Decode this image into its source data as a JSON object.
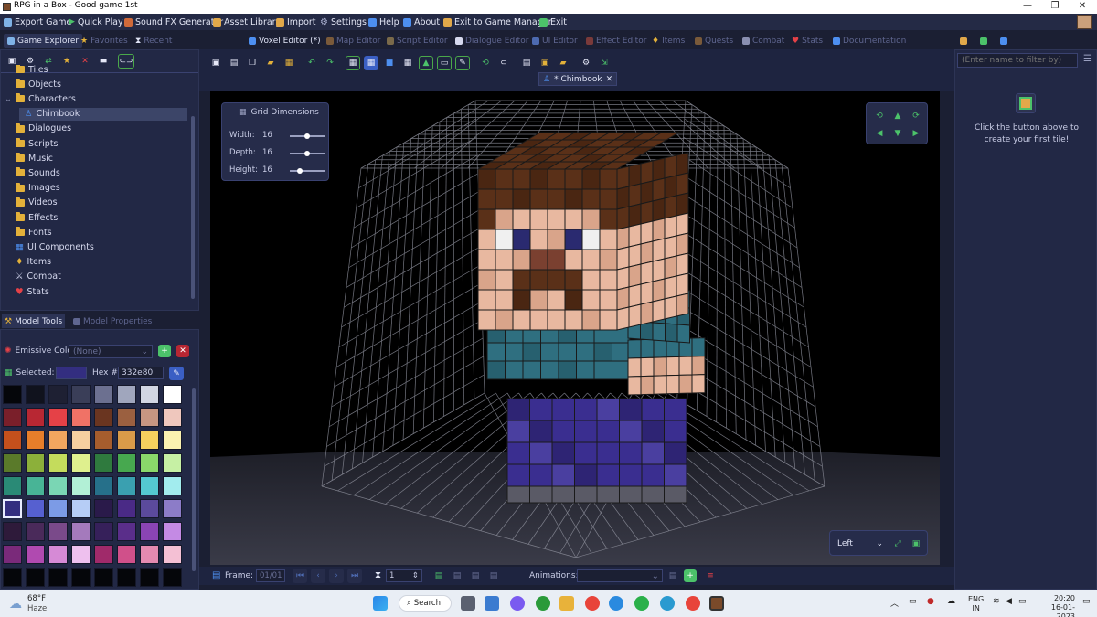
{
  "window": {
    "title": "RPG in a Box - Good game 1st"
  },
  "menu": [
    {
      "label": "Export Game",
      "icon": "export-icon",
      "color": "#7fb2e6"
    },
    {
      "label": "Quick Play",
      "icon": "play-icon",
      "color": "#4cc26a"
    },
    {
      "label": "Sound FX Generator",
      "icon": "sound-fx-icon",
      "color": "#d06a3a"
    },
    {
      "label": "Asset Library",
      "icon": "asset-library-icon",
      "color": "#e1a84a"
    },
    {
      "label": "Import",
      "icon": "import-icon",
      "color": "#e1a84a"
    },
    {
      "label": "Settings",
      "icon": "settings-icon",
      "color": "#aab0d0"
    },
    {
      "label": "Help",
      "icon": "help-icon",
      "color": "#4d8ff0"
    },
    {
      "label": "About",
      "icon": "about-icon",
      "color": "#4d8ff0"
    },
    {
      "label": "Exit to Game Manager",
      "icon": "exit-manager-icon",
      "color": "#e1a84a"
    },
    {
      "label": "Exit",
      "icon": "exit-icon",
      "color": "#4cc26a"
    }
  ],
  "left_tabs": [
    {
      "label": "Game Explorer",
      "icon": "explorer-icon",
      "active": true
    },
    {
      "label": "Favorites",
      "icon": "star-icon",
      "active": false
    },
    {
      "label": "Recent",
      "icon": "hourglass-icon",
      "active": false
    }
  ],
  "editor_tabs": [
    {
      "label": "Voxel Editor (*)",
      "icon": "voxel-editor-icon",
      "active": true
    },
    {
      "label": "Map Editor",
      "icon": "map-editor-icon",
      "active": false
    },
    {
      "label": "Script Editor",
      "icon": "script-editor-icon",
      "active": false
    },
    {
      "label": "Dialogue Editor",
      "icon": "dialogue-editor-icon",
      "active": false
    },
    {
      "label": "UI Editor",
      "icon": "ui-editor-icon",
      "active": false
    },
    {
      "label": "Effect Editor",
      "icon": "effect-editor-icon",
      "active": false
    },
    {
      "label": "Items",
      "icon": "items-icon",
      "active": false
    },
    {
      "label": "Quests",
      "icon": "quests-icon",
      "active": false
    },
    {
      "label": "Combat",
      "icon": "combat-icon",
      "active": false
    },
    {
      "label": "Stats",
      "icon": "stats-icon",
      "active": false
    },
    {
      "label": "Documentation",
      "icon": "documentation-icon",
      "active": false
    }
  ],
  "tree": [
    {
      "label": "Tiles",
      "icon": "folder-icon",
      "child": false
    },
    {
      "label": "Objects",
      "icon": "folder-icon",
      "child": false
    },
    {
      "label": "Characters",
      "icon": "folder-open-icon",
      "child": false
    },
    {
      "label": "Chimbook",
      "icon": "character-icon",
      "child": true,
      "selected": true
    },
    {
      "label": "Dialogues",
      "icon": "folder-icon",
      "child": false
    },
    {
      "label": "Scripts",
      "icon": "folder-icon",
      "child": false
    },
    {
      "label": "Music",
      "icon": "folder-icon",
      "child": false
    },
    {
      "label": "Sounds",
      "icon": "folder-icon",
      "child": false
    },
    {
      "label": "Images",
      "icon": "folder-icon",
      "child": false
    },
    {
      "label": "Videos",
      "icon": "folder-icon",
      "child": false
    },
    {
      "label": "Effects",
      "icon": "folder-icon",
      "child": false
    },
    {
      "label": "Fonts",
      "icon": "folder-icon",
      "child": false
    },
    {
      "label": "UI Components",
      "icon": "ui-components-icon",
      "child": false
    },
    {
      "label": "Items",
      "icon": "items-icon",
      "child": false
    },
    {
      "label": "Combat",
      "icon": "combat-icon",
      "child": false
    },
    {
      "label": "Stats",
      "icon": "stats-icon",
      "child": false
    }
  ],
  "tool_tabs": [
    {
      "label": "Model Tools",
      "active": true
    },
    {
      "label": "Model Properties",
      "active": false
    }
  ],
  "model_tools": {
    "emissive_label": "Emissive Colors:",
    "emissive_value": "(None)",
    "selected_label": "Selected:",
    "selected_color": "#332e80",
    "hex_label": "Hex #:",
    "hex_value": "332e80"
  },
  "palette": [
    "#05060a",
    "#10121d",
    "#1e2033",
    "#3a3e58",
    "#6c7090",
    "#a0a6bd",
    "#d2d6e2",
    "#ffffff",
    "#7a1f2a",
    "#b82733",
    "#e54147",
    "#f07266",
    "#6a3520",
    "#9b6040",
    "#c79682",
    "#efc7bd",
    "#c4501c",
    "#e77e2a",
    "#f2a65f",
    "#f6cfa0",
    "#a65d2d",
    "#d99b49",
    "#f6d15e",
    "#fbf2b0",
    "#5a7a2a",
    "#8cb03a",
    "#c4dc5c",
    "#dff08e",
    "#2f7a3e",
    "#47a84f",
    "#8ad86a",
    "#c6f0a4",
    "#2a8a76",
    "#48b496",
    "#7ad6b4",
    "#b2f0d6",
    "#26708a",
    "#3aa0b0",
    "#54c8d0",
    "#a2ecee",
    "#332e80",
    "#5660d0",
    "#7c9be6",
    "#b6cdf6",
    "#2a1a4a",
    "#4a2a86",
    "#5b4a9c",
    "#8c7cc8",
    "#2e1a3a",
    "#4a2a5a",
    "#7a4a8a",
    "#a47abc",
    "#36205a",
    "#5a2e8a",
    "#8a44b4",
    "#c48ae4",
    "#7a2a7a",
    "#b04ab0",
    "#d68ad6",
    "#eec0ee",
    "#a02a6a",
    "#d0508a",
    "#e48ab0",
    "#f4c0d4",
    "#05060a",
    "#05060a",
    "#05060a",
    "#05060a",
    "#05060a",
    "#05060a",
    "#05060a",
    "#05060a"
  ],
  "doc_tab": {
    "label": "* Chimbook",
    "close": "✕"
  },
  "grid_dimensions": {
    "title": "Grid Dimensions",
    "rows": [
      {
        "label": "Width:",
        "value": "16",
        "level": 0.5
      },
      {
        "label": "Depth:",
        "value": "16",
        "level": 0.5
      },
      {
        "label": "Height:",
        "value": "16",
        "level": 0.3
      }
    ]
  },
  "view_select": {
    "value": "Left"
  },
  "bottom": {
    "frame_label": "Frame:",
    "frame_value": "01/01",
    "speed_value": "1",
    "animations_label": "Animations:"
  },
  "right_panel": {
    "filter_placeholder": "(Enter name to filter by)",
    "hint": "Click the button above to create your first tile!"
  },
  "taskbar": {
    "weather_temp": "68°F",
    "weather_desc": "Haze",
    "search_label": "Search",
    "lang_top": "ENG",
    "lang_bottom": "IN",
    "time": "20:20",
    "date": "16-01-2023"
  }
}
